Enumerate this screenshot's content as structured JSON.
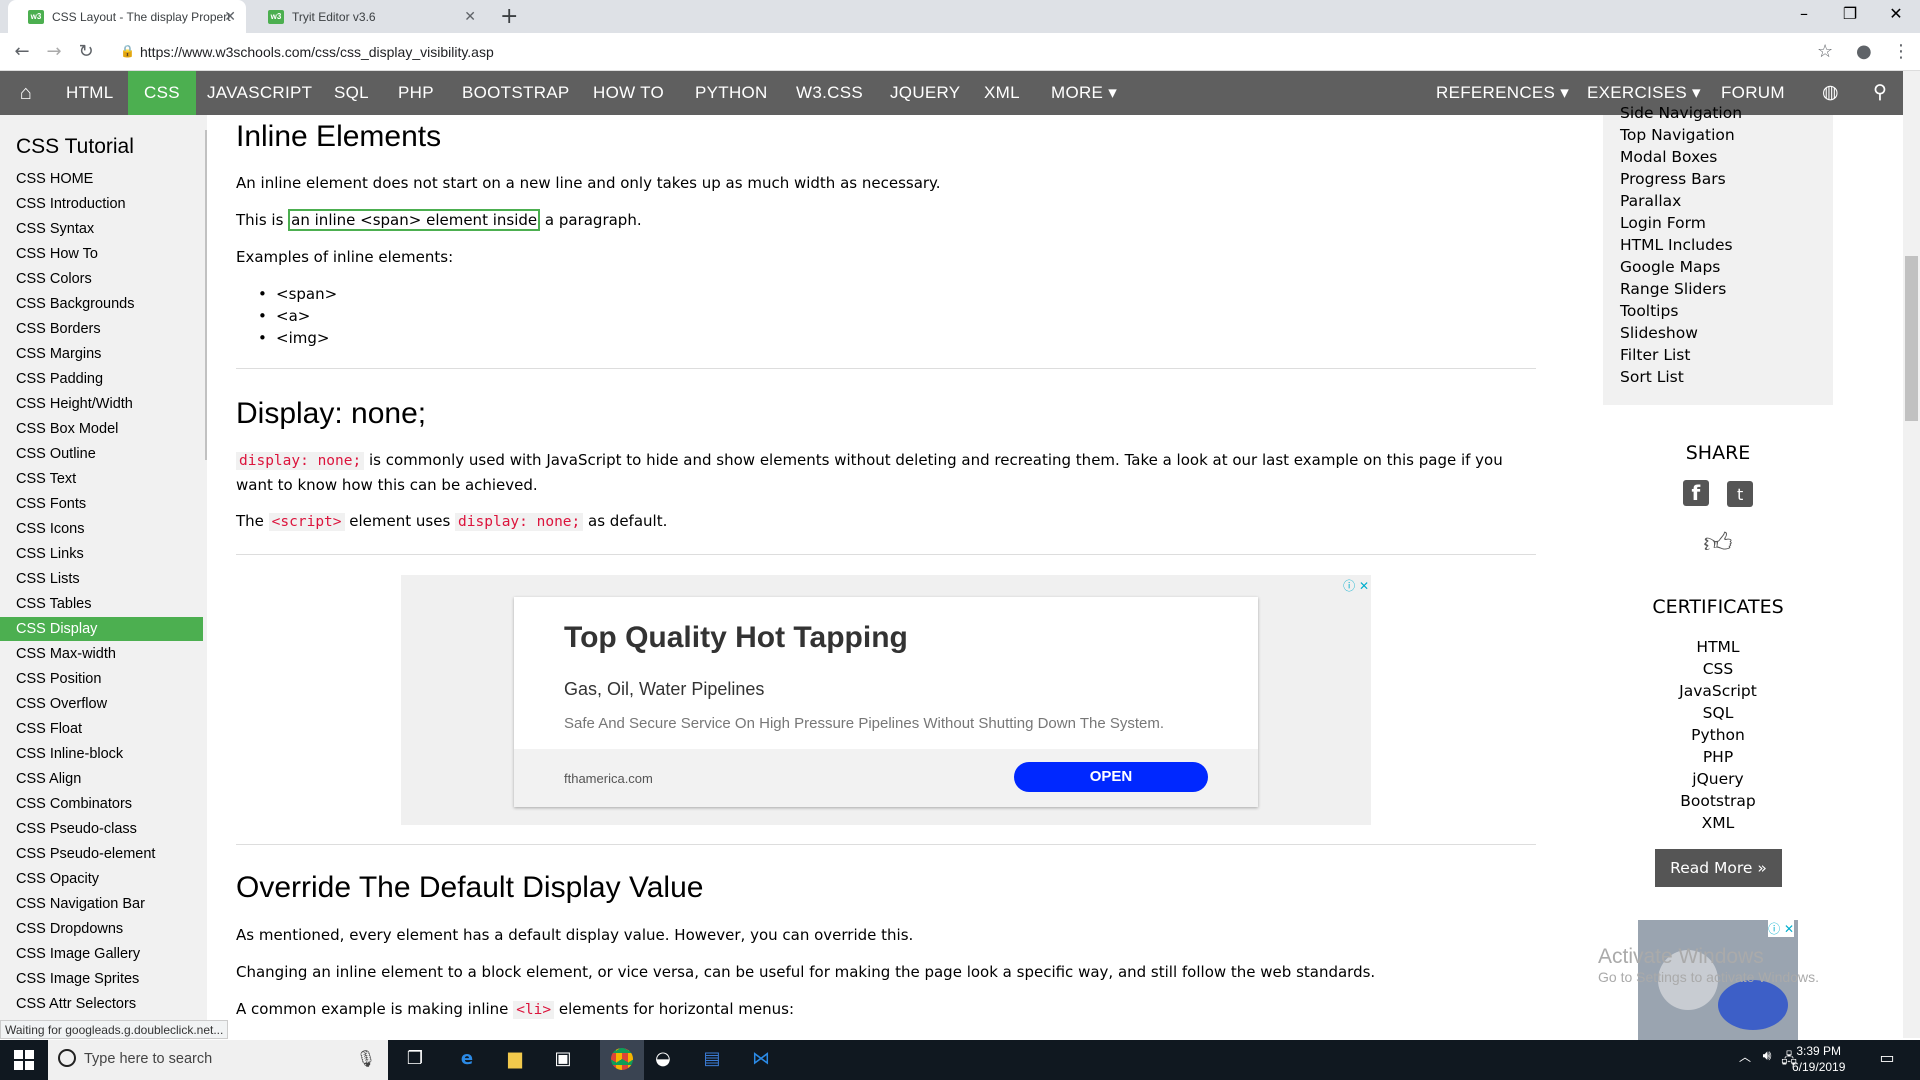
{
  "browser": {
    "tabs": [
      {
        "title": "CSS Layout - The display Propert",
        "favicon": "w3"
      },
      {
        "title": "Tryit Editor v3.6",
        "favicon": "w3"
      }
    ],
    "url": "https://www.w3schools.com/css/css_display_visibility.asp"
  },
  "topnav": {
    "items": [
      "HTML",
      "CSS",
      "JAVASCRIPT",
      "SQL",
      "PHP",
      "BOOTSTRAP",
      "HOW TO",
      "PYTHON",
      "W3.CSS",
      "JQUERY",
      "XML",
      "MORE ▾"
    ],
    "right_items": [
      "REFERENCES ▾",
      "EXERCISES ▾",
      "FORUM"
    ],
    "active": "CSS"
  },
  "sidebar": {
    "title": "CSS Tutorial",
    "items": [
      "CSS HOME",
      "CSS Introduction",
      "CSS Syntax",
      "CSS How To",
      "CSS Colors",
      "CSS Backgrounds",
      "CSS Borders",
      "CSS Margins",
      "CSS Padding",
      "CSS Height/Width",
      "CSS Box Model",
      "CSS Outline",
      "CSS Text",
      "CSS Fonts",
      "CSS Icons",
      "CSS Links",
      "CSS Lists",
      "CSS Tables",
      "CSS Display",
      "CSS Max-width",
      "CSS Position",
      "CSS Overflow",
      "CSS Float",
      "CSS Inline-block",
      "CSS Align",
      "CSS Combinators",
      "CSS Pseudo-class",
      "CSS Pseudo-element",
      "CSS Opacity",
      "CSS Navigation Bar",
      "CSS Dropdowns",
      "CSS Image Gallery",
      "CSS Image Sprites",
      "CSS Attr Selectors"
    ],
    "active": "CSS Display"
  },
  "main": {
    "inline_heading": "Inline Elements",
    "inline_p1": "An inline element does not start on a new line and only takes up as much width as necessary.",
    "inline_p2_pre": "This is ",
    "inline_p2_hl": "an inline <span> element inside",
    "inline_p2_post": " a paragraph.",
    "inline_examples": "Examples of inline elements:",
    "inline_list": [
      "<span>",
      "<a>",
      "<img>"
    ],
    "none_heading": "Display: none;",
    "none_code": "display: none;",
    "none_p1": " is commonly used with JavaScript to hide and show elements without deleting and recreating them. Take a look at our last example on this page if you",
    "none_p1b": "want to know how this can be achieved.",
    "none_p2_pre": "The ",
    "none_p2_code1": "<script>",
    "none_p2_mid": " element uses ",
    "none_p2_code2": "display: none;",
    "none_p2_post": " as default.",
    "override_heading": "Override The Default Display Value",
    "override_p1": "As mentioned, every element has a default display value. However, you can override this.",
    "override_p2": "Changing an inline element to a block element, or vice versa, can be useful for making the page look a specific way, and still follow the web standards.",
    "override_p3_pre": "A common example is making inline ",
    "override_p3_code": "<li>",
    "override_p3_post": " elements for horizontal menus:"
  },
  "ad": {
    "title": "Top Quality Hot Tapping",
    "subtitle": "Gas, Oil, Water Pipelines",
    "description": "Safe And Secure Service On High Pressure Pipelines Without Shutting Down The System.",
    "domain": "fthamerica.com",
    "button": "OPEN"
  },
  "right_sidebar": {
    "items": [
      "Side Navigation",
      "Top Navigation",
      "Modal Boxes",
      "Progress Bars",
      "Parallax",
      "Login Form",
      "HTML Includes",
      "Google Maps",
      "Range Sliders",
      "Tooltips",
      "Slideshow",
      "Filter List",
      "Sort List"
    ],
    "share_title": "SHARE",
    "certificates_title": "CERTIFICATES",
    "certificates": [
      "HTML",
      "CSS",
      "JavaScript",
      "SQL",
      "Python",
      "PHP",
      "jQuery",
      "Bootstrap",
      "XML"
    ],
    "read_more": "Read More »"
  },
  "watermark": {
    "line1": "Activate Windows",
    "line2": "Go to Settings to activate Windows."
  },
  "status_bar": "Waiting for googleads.g.doubleclick.net...",
  "taskbar": {
    "search_placeholder": "Type here to search",
    "time": "3:39 PM",
    "date": "6/19/2019"
  },
  "colors": {
    "accent": "#4caf50",
    "nav_bg": "#5f5f5f",
    "code_red": "#dc143c",
    "ad_button": "#0028ff"
  }
}
